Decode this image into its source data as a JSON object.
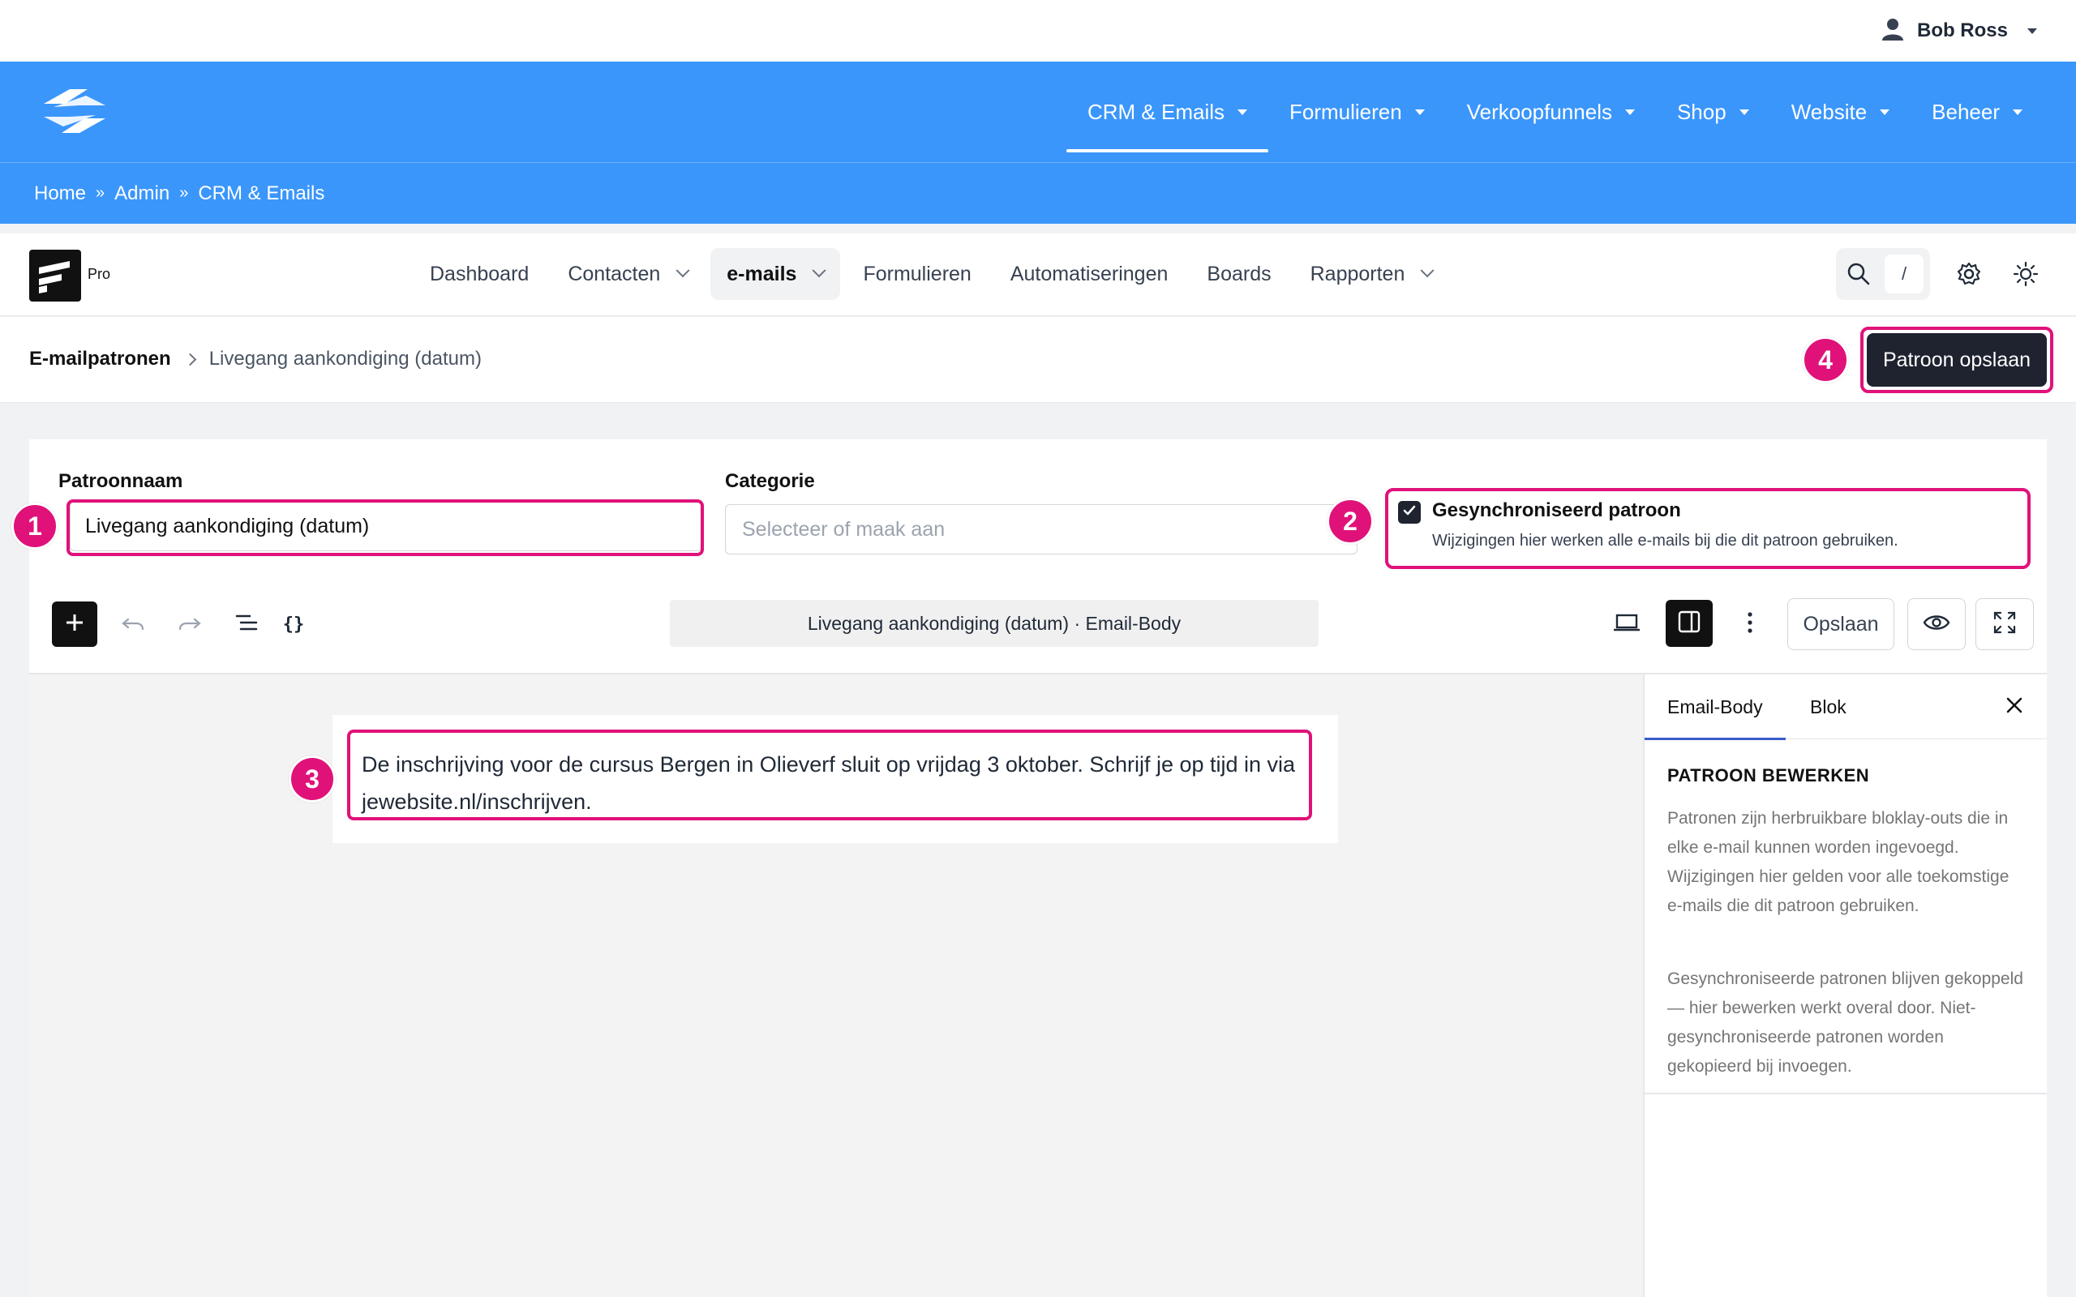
{
  "admin_bar": {
    "user_name": "Bob Ross"
  },
  "site_nav": {
    "items": [
      {
        "label": "CRM & Emails",
        "active": true
      },
      {
        "label": "Formulieren"
      },
      {
        "label": "Verkoopfunnels"
      },
      {
        "label": "Shop"
      },
      {
        "label": "Website"
      },
      {
        "label": "Beheer"
      }
    ]
  },
  "breadcrumb": {
    "items": [
      "Home",
      "Admin",
      "CRM & Emails"
    ],
    "separator": "»"
  },
  "app_nav": {
    "badge": "Pro",
    "items": [
      {
        "label": "Dashboard"
      },
      {
        "label": "Contacten"
      },
      {
        "label": "e-mails",
        "active": true
      },
      {
        "label": "Formulieren"
      },
      {
        "label": "Automatiseringen"
      },
      {
        "label": "Boards"
      },
      {
        "label": "Rapporten"
      }
    ],
    "search_shortcut": "/"
  },
  "page_header": {
    "parent": "E-mailpatronen",
    "current": "Livegang aankondiging (datum)",
    "save_label": "Patroon opslaan"
  },
  "form": {
    "name_label": "Patroonnaam",
    "name_value": "Livegang aankondiging (datum)",
    "category_label": "Categorie",
    "category_placeholder": "Selecteer of maak aan",
    "sync_title": "Gesynchroniseerd patroon",
    "sync_desc": "Wijzigingen hier werken alle e-mails bij die dit patroon gebruiken.",
    "sync_checked": true
  },
  "editor": {
    "doc_title": "Livegang aankondiging (datum) · Email-Body",
    "save_label": "Opslaan",
    "paragraph": "De inschrijving voor de cursus Bergen in Olieverf sluit op vrijdag 3 oktober. Schrijf je op tijd in via jewebsite.nl/inschrijven."
  },
  "sidebar": {
    "tabs": [
      "Email-Body",
      "Blok"
    ],
    "heading": "PATROON BEWERKEN",
    "p1": "Patronen zijn herbruikbare bloklay-outs die in elke e-mail kunnen worden ingevoegd. Wijzigingen hier gelden voor alle toekomstige e-mails die dit patroon gebruiken.",
    "p2": "Gesynchroniseerde patronen blijven gekoppeld — hier bewerken werkt overal door. Niet-gesynchroniseerde patronen worden gekopieerd bij invoegen."
  },
  "annotations": [
    "1",
    "2",
    "3",
    "4"
  ],
  "colors": {
    "brand_blue": "#3a96fb",
    "highlight_pink": "#e0127a",
    "dark_button": "#1f2330"
  }
}
